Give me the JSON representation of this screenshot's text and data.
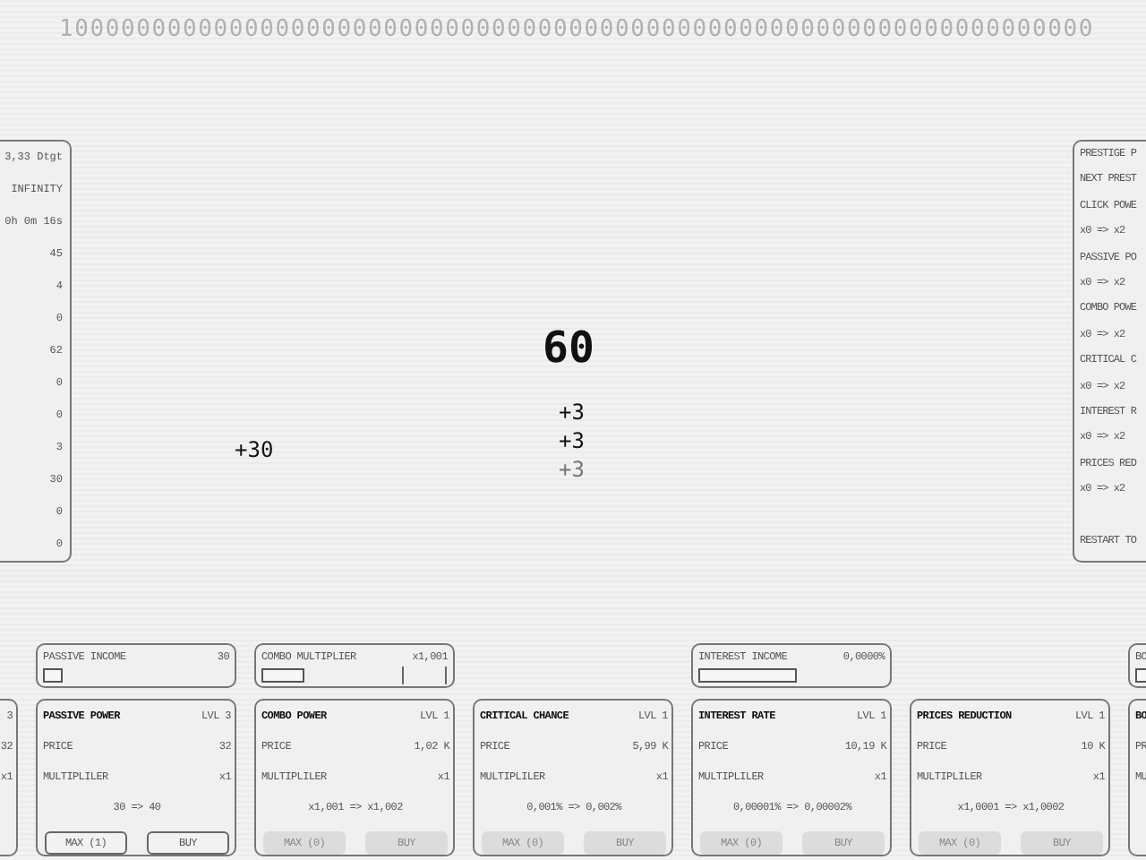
{
  "counter": "1000000000000000000000000000000000000000000000000000000000000000000",
  "stats": [
    "3,33 Dtgt",
    "INFINITY",
    "0h 0m 16s",
    "45",
    "4",
    "0",
    "62",
    "0",
    "0",
    "3",
    "30",
    "0",
    "0"
  ],
  "prestige": {
    "lines": [
      "PRESTIGE P",
      "NEXT PREST",
      "CLICK POWE",
      "x0 => x2",
      "PASSIVE PO",
      "x0 => x2",
      "COMBO POWE",
      "x0 => x2",
      "CRITICAL C",
      "x0 => x2",
      "INTEREST R",
      "x0 => x2",
      "PRICES RED",
      "x0 => x2"
    ],
    "restart": "RESTART TO"
  },
  "score": "60",
  "popups": [
    {
      "text": "+30",
      "faded": false
    },
    {
      "text": "+3",
      "faded": false
    },
    {
      "text": "+3",
      "faded": false
    },
    {
      "text": "+3",
      "faded": true
    }
  ],
  "columns": [
    {
      "card": {
        "level": "3",
        "price": "32",
        "mult": "x1"
      }
    },
    {
      "income": {
        "label": "PASSIVE INCOME",
        "value": "30",
        "level": 0.11
      },
      "card": {
        "title": "PASSIVE POWER",
        "level": "LVL 3",
        "price_label": "PRICE",
        "price": "32",
        "mult_label": "MULTIPLILER",
        "mult": "x1",
        "change": "30 => 40",
        "max": {
          "label": "MAX (1)",
          "disabled": false
        },
        "buy": {
          "label": "BUY",
          "disabled": false
        }
      }
    },
    {
      "income": {
        "label": "COMBO MULTIPLIER",
        "value": "x1,001",
        "level": 0.24,
        "marks": true
      },
      "card": {
        "title": "COMBO POWER",
        "level": "LVL 1",
        "price_label": "PRICE",
        "price": "1,02 K",
        "mult_label": "MULTIPLILER",
        "mult": "x1",
        "change": "x1,001 => x1,002",
        "max": {
          "label": "MAX (0)",
          "disabled": true
        },
        "buy": {
          "label": "BUY",
          "disabled": true
        }
      }
    },
    {
      "card": {
        "title": "CRITICAL CHANCE",
        "level": "LVL 1",
        "price_label": "PRICE",
        "price": "5,99 K",
        "mult_label": "MULTIPLILER",
        "mult": "x1",
        "change": "0,001% => 0,002%",
        "max": {
          "label": "MAX (0)",
          "disabled": true
        },
        "buy": {
          "label": "BUY",
          "disabled": true
        }
      }
    },
    {
      "income": {
        "label": "INTEREST INCOME",
        "value": "0,0000%",
        "level": 0.55
      },
      "card": {
        "title": "INTEREST RATE",
        "level": "LVL 1",
        "price_label": "PRICE",
        "price": "10,19 K",
        "mult_label": "MULTIPLILER",
        "mult": "x1",
        "change": "0,00001% => 0,00002%",
        "max": {
          "label": "MAX (0)",
          "disabled": true
        },
        "buy": {
          "label": "BUY",
          "disabled": true
        }
      }
    },
    {
      "card": {
        "title": "PRICES REDUCTION",
        "level": "LVL 1",
        "price_label": "PRICE",
        "price": "10 K",
        "mult_label": "MULTIPLILER",
        "mult": "x1",
        "change": "x1,0001 => x1,0002",
        "max": {
          "label": "MAX (0)",
          "disabled": true
        },
        "buy": {
          "label": "BUY",
          "disabled": true
        }
      }
    },
    {
      "income": {
        "label": "BO"
      },
      "card": {
        "title": "BO",
        "price_label": "PR",
        "mult_label": "MU"
      }
    }
  ]
}
